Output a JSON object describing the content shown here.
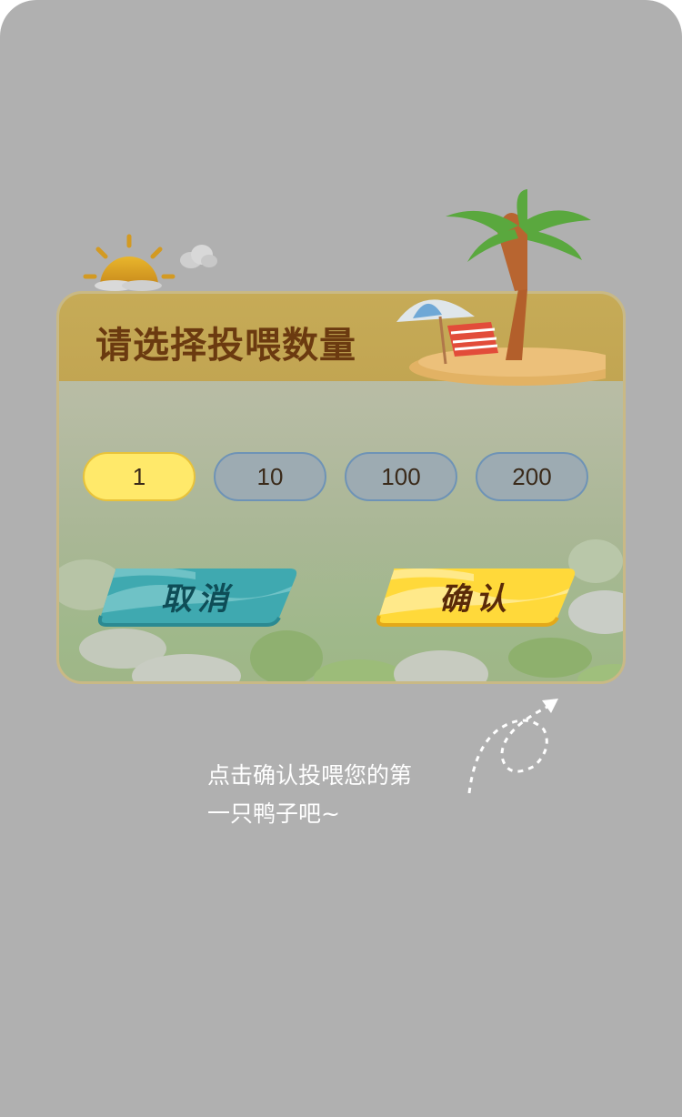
{
  "dialog": {
    "title": "请选择投喂数量",
    "options": [
      {
        "label": "1",
        "selected": true
      },
      {
        "label": "10",
        "selected": false
      },
      {
        "label": "100",
        "selected": false
      },
      {
        "label": "200",
        "selected": false
      }
    ],
    "cancel_label": "取消",
    "confirm_label": "确认"
  },
  "hint": {
    "line1": "点击确认投喂您的第",
    "line2": "一只鸭子吧~"
  },
  "colors": {
    "overlay": "#b0b0b0",
    "header": "#c6ab57",
    "selected_option": "#ffe96a",
    "option": "#9dabb2",
    "cancel_button": "#3fa9b0",
    "confirm_button": "#ffd93a",
    "title_text": "#6b3a10"
  }
}
